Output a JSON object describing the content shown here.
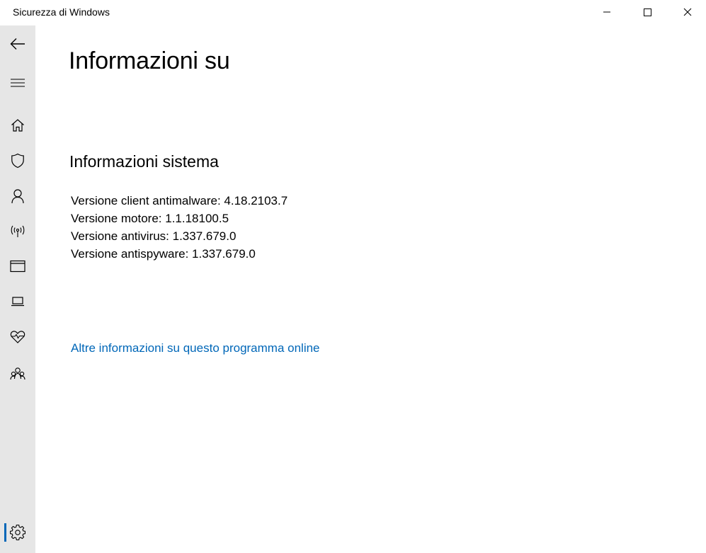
{
  "window": {
    "title": "Sicurezza di Windows"
  },
  "sidebar": {
    "items": [
      {
        "name": "back",
        "icon": "back-arrow-icon"
      },
      {
        "name": "menu",
        "icon": "hamburger-menu-icon"
      },
      {
        "name": "home",
        "icon": "home-icon"
      },
      {
        "name": "virus-protection",
        "icon": "shield-icon"
      },
      {
        "name": "account-protection",
        "icon": "person-icon"
      },
      {
        "name": "firewall-network",
        "icon": "wireless-antenna-icon"
      },
      {
        "name": "app-browser-control",
        "icon": "browser-window-icon"
      },
      {
        "name": "device-security",
        "icon": "laptop-icon"
      },
      {
        "name": "device-performance",
        "icon": "heart-pulse-icon"
      },
      {
        "name": "family-options",
        "icon": "family-icon"
      },
      {
        "name": "settings",
        "icon": "gear-icon",
        "active": true
      }
    ]
  },
  "main": {
    "title": "Informazioni su",
    "section_title": "Informazioni sistema",
    "info": [
      "Versione client antimalware: 4.18.2103.7",
      "Versione motore: 1.1.18100.5",
      "Versione antivirus: 1.337.679.0",
      "Versione antispyware: 1.337.679.0"
    ],
    "link_text": "Altre informazioni su questo programma online"
  },
  "colors": {
    "accent": "#0067b8",
    "sidebar_bg": "#e6e6e6",
    "background": "#ffffff"
  }
}
